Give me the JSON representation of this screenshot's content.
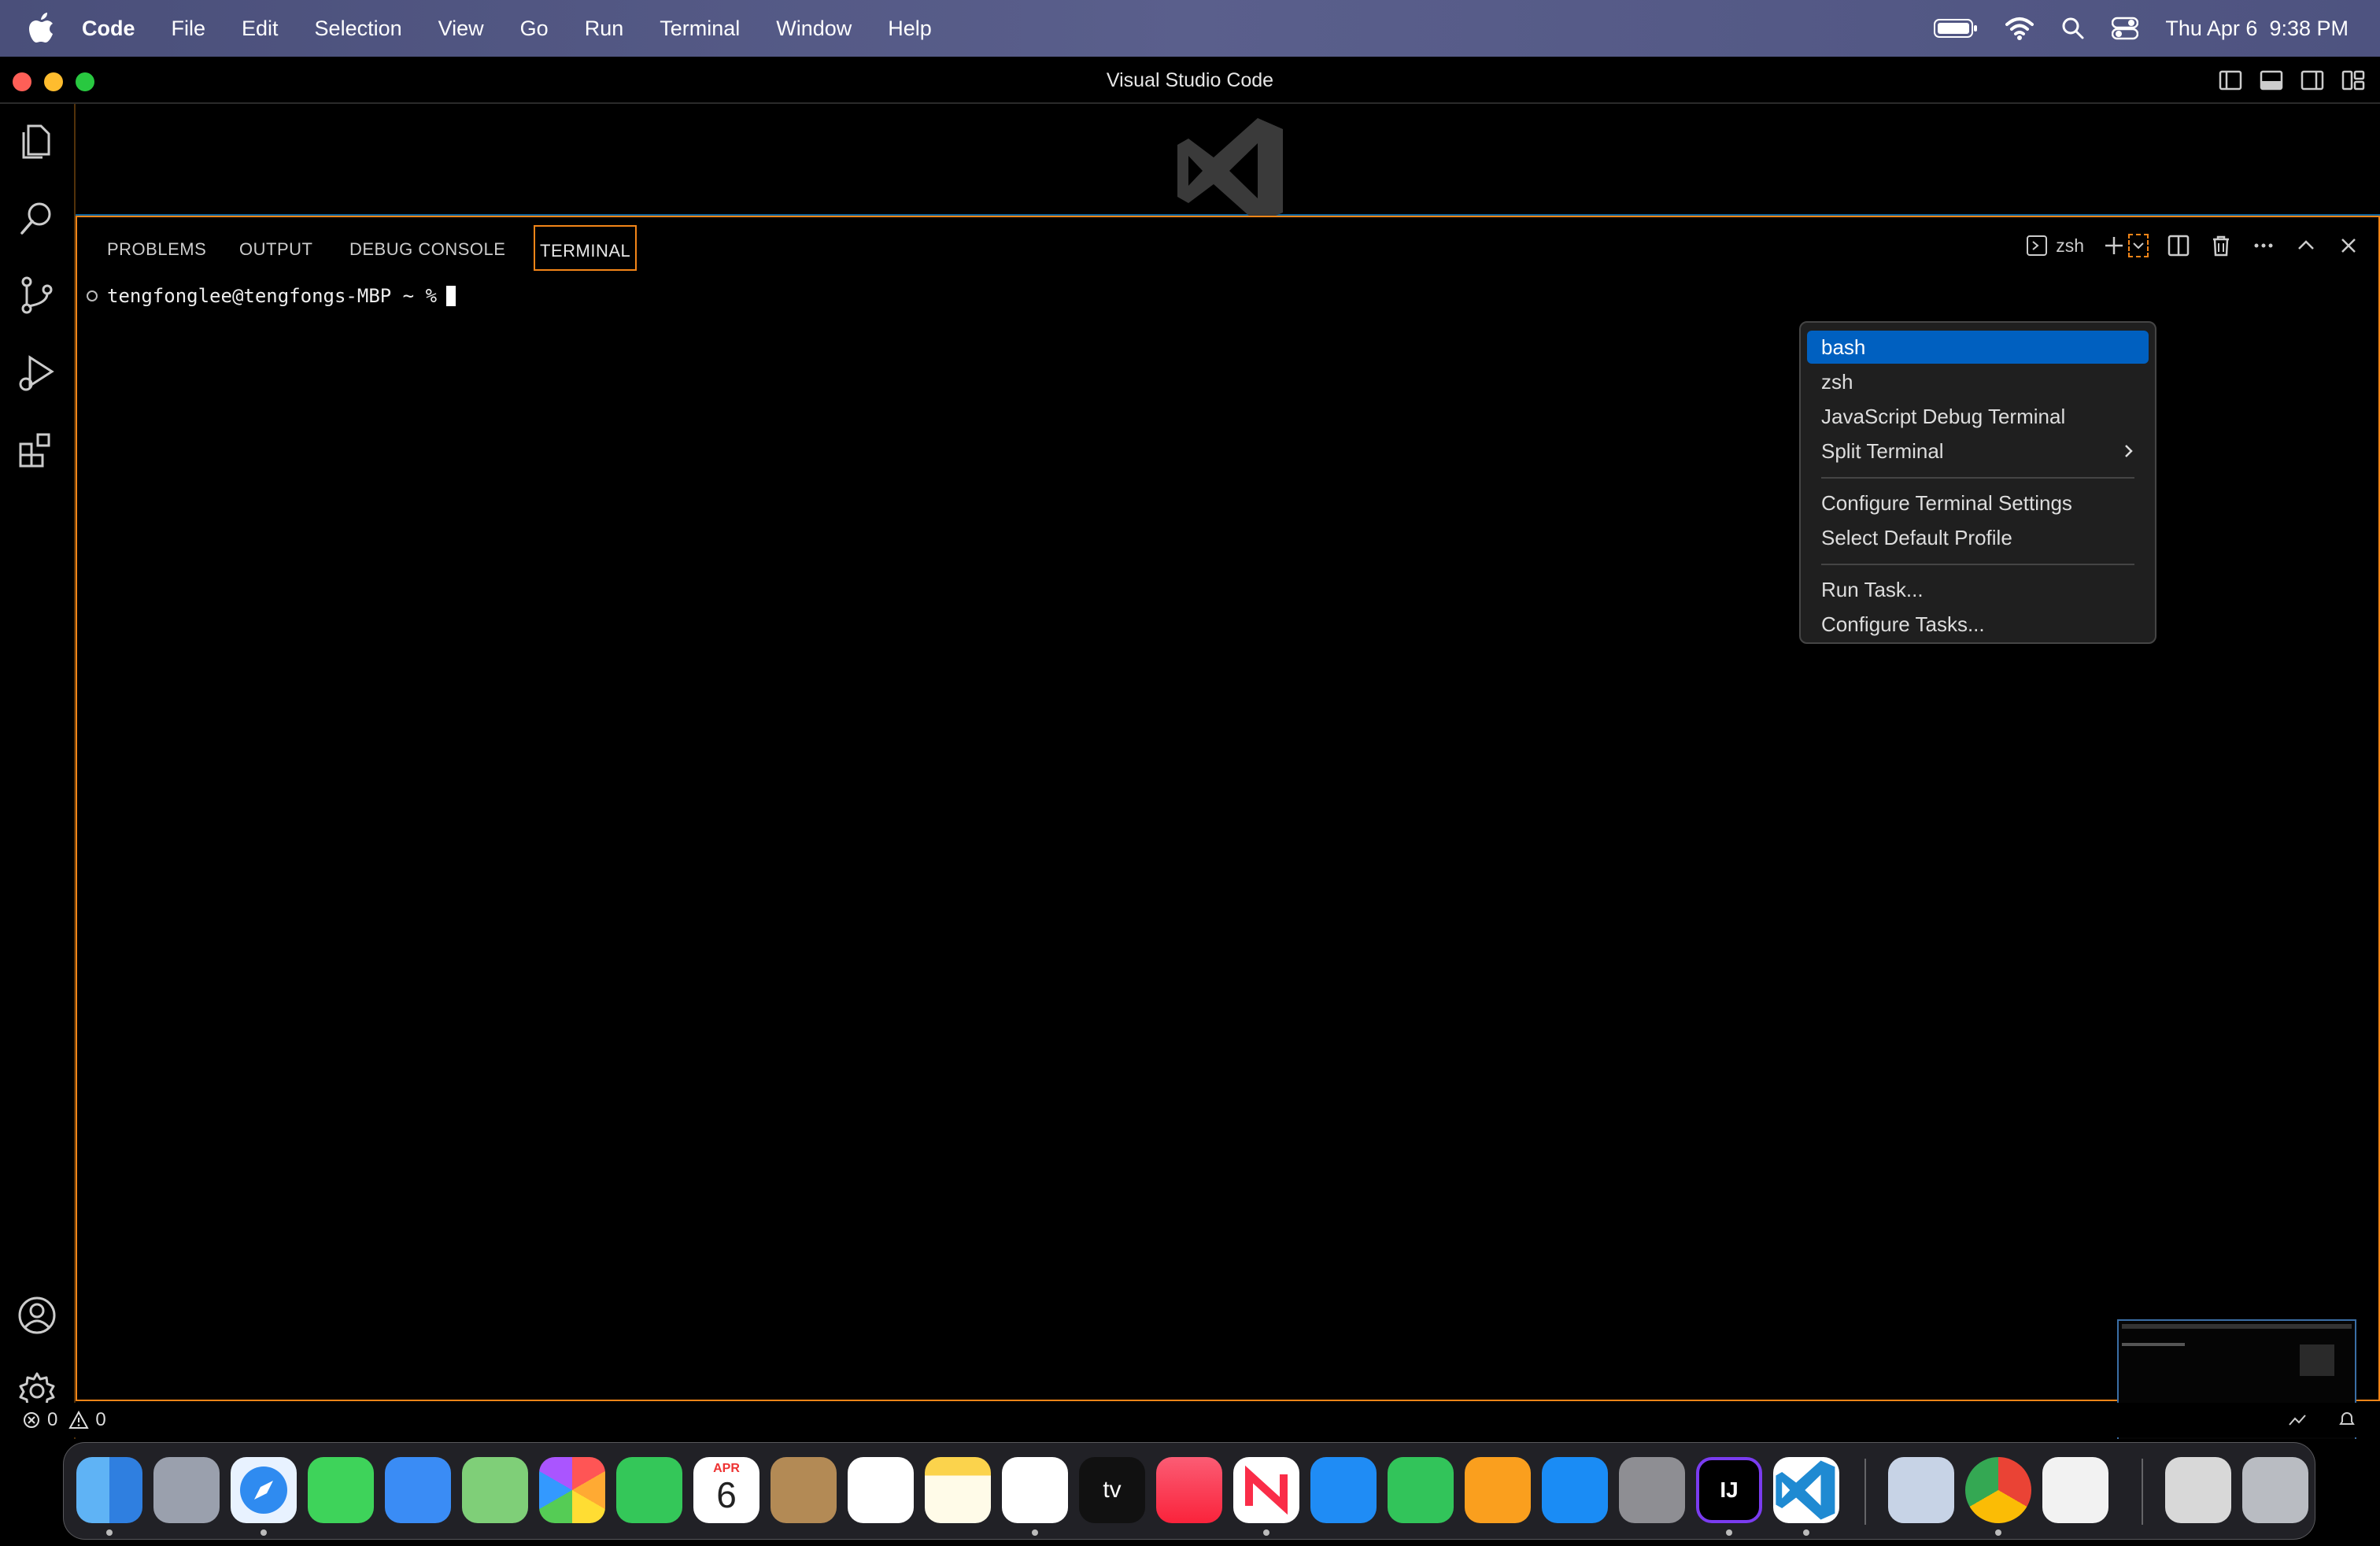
{
  "menubar": {
    "app_name": "Code",
    "items": [
      "File",
      "Edit",
      "Selection",
      "View",
      "Go",
      "Run",
      "Terminal",
      "Window",
      "Help"
    ],
    "clock": "Thu Apr 6  9:38 PM"
  },
  "window": {
    "title": "Visual Studio Code"
  },
  "panel": {
    "tabs": [
      "PROBLEMS",
      "OUTPUT",
      "DEBUG CONSOLE",
      "TERMINAL"
    ],
    "active_tab": "TERMINAL",
    "terminal_profile": "zsh"
  },
  "terminal": {
    "prompt": "tengfonglee@tengfongs-MBP ~ %"
  },
  "profile_menu": {
    "items": [
      {
        "label": "bash",
        "selected": true
      },
      {
        "label": "zsh"
      },
      {
        "label": "JavaScript Debug Terminal"
      },
      {
        "label": "Split Terminal",
        "submenu": true
      },
      {
        "label": "Configure Terminal Settings"
      },
      {
        "label": "Select Default Profile"
      },
      {
        "label": "Run Task..."
      },
      {
        "label": "Configure Tasks..."
      }
    ]
  },
  "statusbar": {
    "errors": "0",
    "warnings": "0"
  },
  "dock": {
    "calendar_month": "APR",
    "calendar_day": "6",
    "tv_label": "tv",
    "intellij_label": "IJ"
  },
  "colors": {
    "focus_border": "#f38518",
    "menu_selection": "#0060c0",
    "menubar_bg": "#52578a"
  }
}
